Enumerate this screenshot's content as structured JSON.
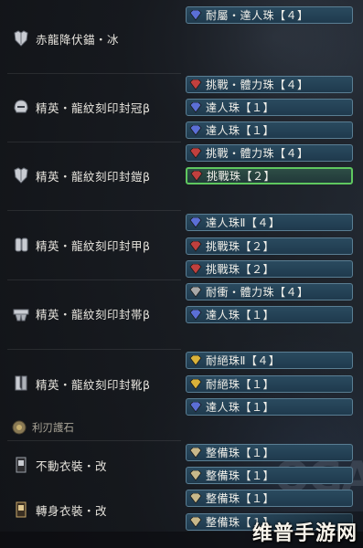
{
  "armor": [
    {
      "name": "赤龍降伏錨・冰",
      "icon": "chest-armor-icon"
    },
    {
      "name": "精英・龍紋刻印封冠β",
      "icon": "helmet-icon"
    },
    {
      "name": "精英・龍紋刻印封鎧β",
      "icon": "chest-armor-icon"
    },
    {
      "name": "精英・龍紋刻印封甲β",
      "icon": "arm-armor-icon"
    },
    {
      "name": "精英・龍紋刻印封帯β",
      "icon": "waist-armor-icon"
    },
    {
      "name": "精英・龍紋刻印封靴β",
      "icon": "leg-armor-icon"
    },
    {
      "name": "不動衣裝・改",
      "icon": "mantle-icon"
    },
    {
      "name": "轉身衣裝・改",
      "icon": "mantle-icon"
    }
  ],
  "charm": {
    "name": "利刃護石",
    "icon": "charm-icon"
  },
  "slots": [
    {
      "label": "耐屬・達人珠【４】",
      "color": "#5b6fd6"
    },
    {
      "label": "挑戰・體力珠【４】",
      "color": "#c0403e"
    },
    {
      "label": "達人珠【１】",
      "color": "#5b6fd6"
    },
    {
      "label": "達人珠【１】",
      "color": "#5b6fd6"
    },
    {
      "label": "挑戰・體力珠【４】",
      "color": "#c0403e"
    },
    {
      "label": "挑戰珠【２】",
      "color": "#c0403e",
      "selected": true
    },
    {
      "label": "達人珠Ⅱ【４】",
      "color": "#5b6fd6"
    },
    {
      "label": "挑戰珠【２】",
      "color": "#c0403e"
    },
    {
      "label": "挑戰珠【２】",
      "color": "#c0403e"
    },
    {
      "label": "耐衝・體力珠【４】",
      "color": "#a8a8a8"
    },
    {
      "label": "達人珠【１】",
      "color": "#5b6fd6"
    },
    {
      "label": "耐絕珠Ⅱ【４】",
      "color": "#d9b23a"
    },
    {
      "label": "耐絕珠【１】",
      "color": "#d9b23a"
    },
    {
      "label": "達人珠【１】",
      "color": "#5b6fd6"
    },
    {
      "label": "整備珠【１】",
      "color": "#c8b88a"
    },
    {
      "label": "整備珠【１】",
      "color": "#c8b88a"
    },
    {
      "label": "整備珠【１】",
      "color": "#c8b88a"
    },
    {
      "label": "整備珠【１】",
      "color": "#c8b88a"
    }
  ],
  "watermark": "维普手游网"
}
